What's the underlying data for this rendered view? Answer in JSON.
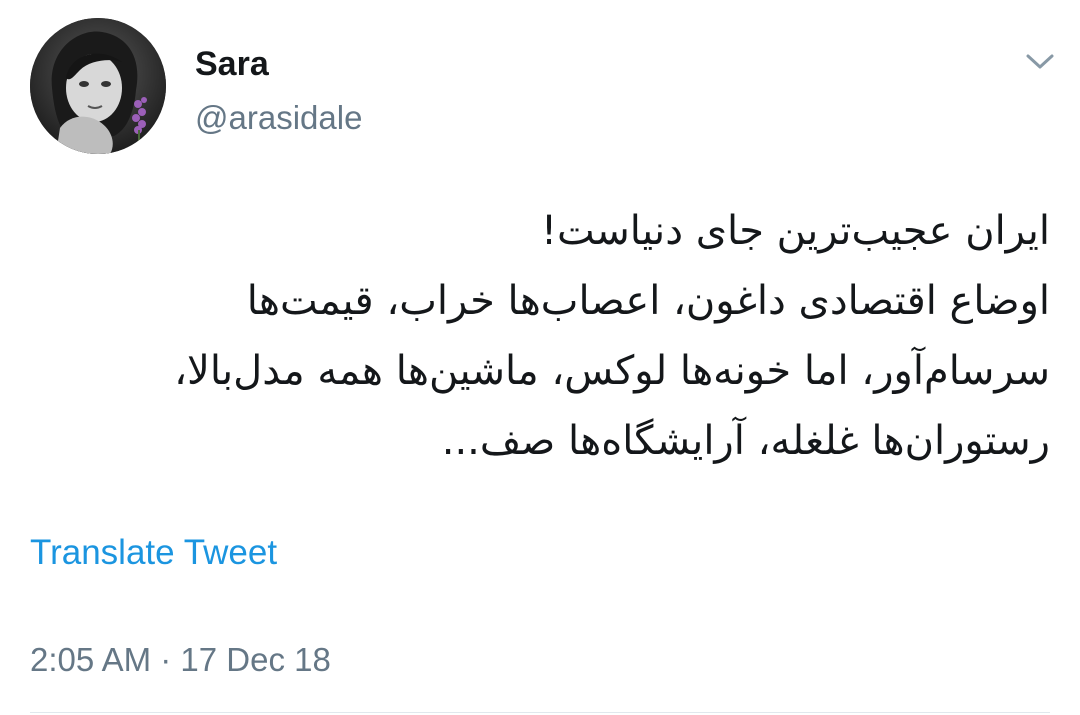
{
  "author": {
    "display_name": "Sara",
    "handle": "@arasidale"
  },
  "menu": {
    "icon": "chevron-down-icon"
  },
  "tweet": {
    "lines": [
      "ایران عجیب‌ترین جای دنیاست!",
      "اوضاع اقتصادی داغون، اعصاب‌ها خراب، قیمت‌ها",
      "سرسام‌آور، اما خونه‌ها لوکس، ماشین‌ها همه مدل‌بالا،",
      "رستوران‌ها غلغله، آرایشگاه‌ها صف..."
    ],
    "translate_label": "Translate Tweet",
    "timestamp": "2:05 AM · 17 Dec 18"
  },
  "colors": {
    "link": "#1b95e0",
    "secondary_text": "#657786",
    "primary_text": "#14171a"
  }
}
